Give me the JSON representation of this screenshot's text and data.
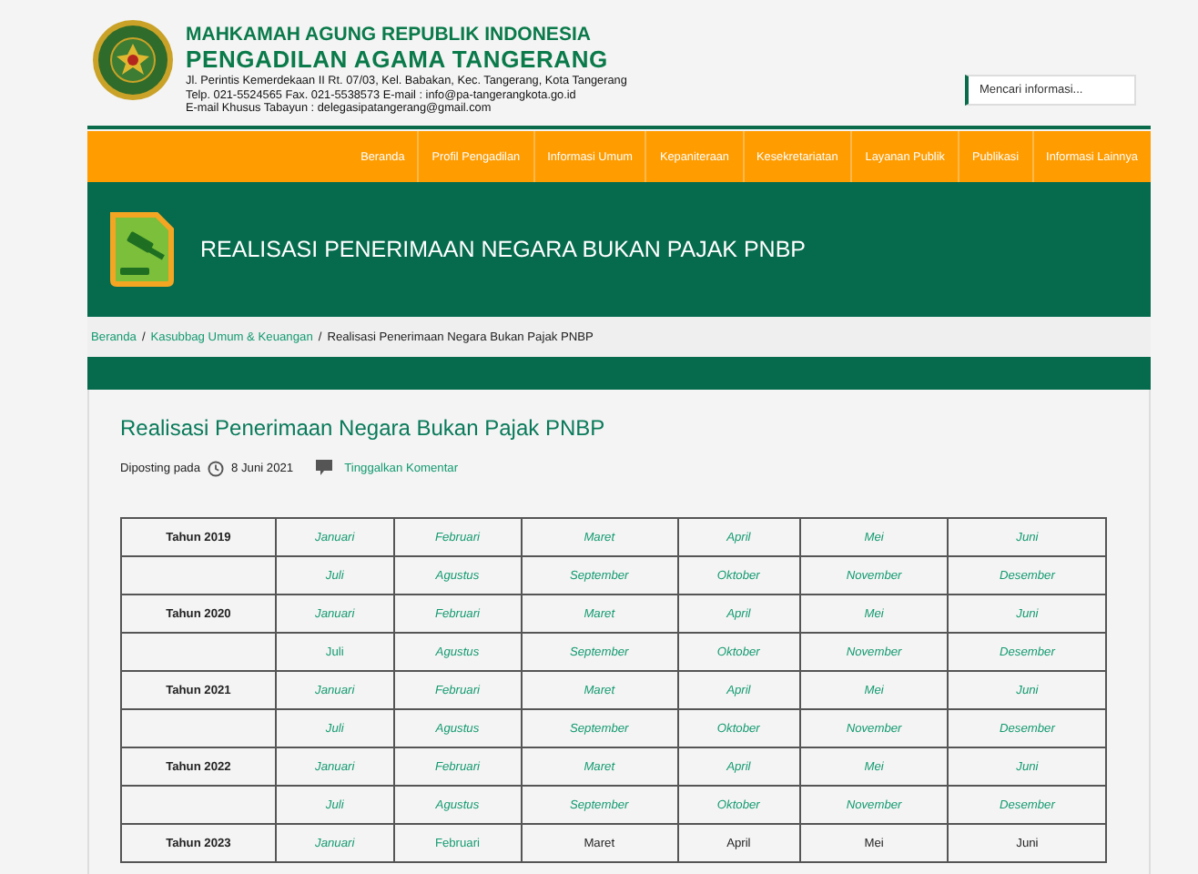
{
  "header": {
    "org": "MAHKAMAH AGUNG REPUBLIK INDONESIA",
    "court": "PENGADILAN AGAMA TANGERANG",
    "address": [
      "Jl. Perintis Kemerdekaan II Rt. 07/03, Kel. Babakan, Kec. Tangerang, Kota Tangerang",
      "Telp. 021-5524565 Fax. 021-5538573 E-mail : info@pa-tangerangkota.go.id",
      "E-mail Khusus Tabayun : delegasipatangerang@gmail.com"
    ]
  },
  "search": {
    "placeholder": "Mencari informasi..."
  },
  "nav": [
    "Beranda",
    "Profil Pengadilan",
    "Informasi Umum",
    "Kepaniteraan",
    "Kesekretariatan",
    "Layanan Publik",
    "Publikasi",
    "Informasi Lainnya"
  ],
  "banner": {
    "title": "REALISASI PENERIMAAN NEGARA BUKAN PAJAK PNBP"
  },
  "breadcrumb": {
    "separator": "/",
    "links": [
      "Beranda",
      "Kasubbag Umum & Keuangan"
    ],
    "current": "Realisasi Penerimaan Negara Bukan Pajak PNBP"
  },
  "post": {
    "title": "Realisasi Penerimaan Negara Bukan Pajak PNBP",
    "posted_label": "Diposting pada",
    "date": "8 Juni 2021",
    "comment_link": "Tinggalkan Komentar"
  },
  "table": {
    "rows": [
      {
        "year": "Tahun 2019",
        "cells": [
          {
            "text": "Januari",
            "kind": "italic-link"
          },
          {
            "text": "Februari",
            "kind": "italic-link"
          },
          {
            "text": "Maret",
            "kind": "italic-link"
          },
          {
            "text": "April",
            "kind": "italic-link"
          },
          {
            "text": "Mei",
            "kind": "italic-link"
          },
          {
            "text": "Juni",
            "kind": "italic-link"
          }
        ]
      },
      {
        "cells": [
          {
            "text": "Juli",
            "kind": "italic-link"
          },
          {
            "text": "Agustus",
            "kind": "italic-link"
          },
          {
            "text": "September",
            "kind": "italic-link"
          },
          {
            "text": "Oktober",
            "kind": "italic-link"
          },
          {
            "text": "November",
            "kind": "italic-link"
          },
          {
            "text": "Desember",
            "kind": "italic-link"
          }
        ]
      },
      {
        "year": "Tahun 2020",
        "cells": [
          {
            "text": "Januari",
            "kind": "italic-link"
          },
          {
            "text": "Februari",
            "kind": "italic-link"
          },
          {
            "text": "Maret",
            "kind": "italic-link"
          },
          {
            "text": "April",
            "kind": "italic-link"
          },
          {
            "text": "Mei",
            "kind": "italic-link"
          },
          {
            "text": "Juni",
            "kind": "italic-link"
          }
        ]
      },
      {
        "cells": [
          {
            "text": "Juli",
            "kind": "link"
          },
          {
            "text": "Agustus",
            "kind": "italic-link"
          },
          {
            "text": "September",
            "kind": "italic-link"
          },
          {
            "text": "Oktober",
            "kind": "italic-link"
          },
          {
            "text": "November",
            "kind": "italic-link"
          },
          {
            "text": "Desember",
            "kind": "italic-link"
          }
        ]
      },
      {
        "year": "Tahun 2021",
        "cells": [
          {
            "text": "Januari",
            "kind": "italic-link"
          },
          {
            "text": "Februari",
            "kind": "italic-link"
          },
          {
            "text": "Maret",
            "kind": "italic-link"
          },
          {
            "text": "April",
            "kind": "italic-link"
          },
          {
            "text": "Mei",
            "kind": "italic-link"
          },
          {
            "text": "Juni",
            "kind": "italic-link"
          }
        ]
      },
      {
        "cells": [
          {
            "text": "Juli",
            "kind": "italic-link"
          },
          {
            "text": "Agustus",
            "kind": "italic-link"
          },
          {
            "text": "September",
            "kind": "italic-link"
          },
          {
            "text": "Oktober",
            "kind": "italic-link"
          },
          {
            "text": "November",
            "kind": "italic-link"
          },
          {
            "text": "Desember",
            "kind": "italic-link"
          }
        ]
      },
      {
        "year": "Tahun 2022",
        "cells": [
          {
            "text": "Januari",
            "kind": "italic-link"
          },
          {
            "text": "Februari",
            "kind": "italic-link"
          },
          {
            "text": "Maret",
            "kind": "italic-link"
          },
          {
            "text": "April",
            "kind": "italic-link"
          },
          {
            "text": "Mei",
            "kind": "italic-link"
          },
          {
            "text": "Juni",
            "kind": "italic-link"
          }
        ]
      },
      {
        "cells": [
          {
            "text": "Juli",
            "kind": "italic-link"
          },
          {
            "text": "Agustus",
            "kind": "italic-link"
          },
          {
            "text": "September",
            "kind": "italic-link"
          },
          {
            "text": "Oktober",
            "kind": "italic-link"
          },
          {
            "text": "November",
            "kind": "italic-link"
          },
          {
            "text": "Desember",
            "kind": "italic-link"
          }
        ]
      },
      {
        "year": "Tahun 2023",
        "cells": [
          {
            "text": "Januari",
            "kind": "italic-link"
          },
          {
            "text": "Februari",
            "kind": "link"
          },
          {
            "text": "Maret",
            "kind": "plain"
          },
          {
            "text": "April",
            "kind": "plain"
          },
          {
            "text": "Mei",
            "kind": "plain"
          },
          {
            "text": "Juni",
            "kind": "plain"
          }
        ]
      }
    ]
  }
}
